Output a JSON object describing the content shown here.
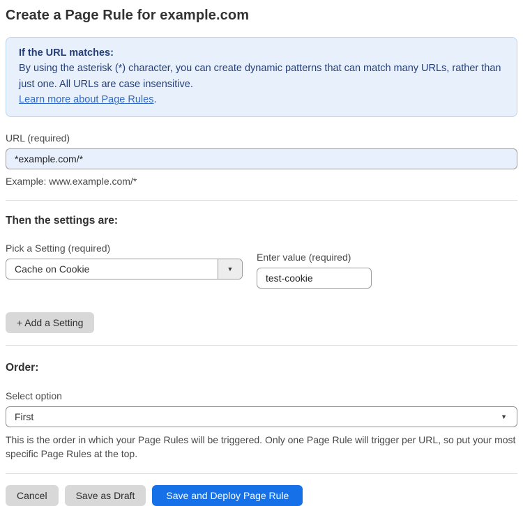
{
  "page": {
    "title": "Create a Page Rule for example.com"
  },
  "info_box": {
    "heading": "If the URL matches:",
    "body": "By using the asterisk (*) character, you can create dynamic patterns that can match many URLs, rather than just one. All URLs are case insensitive.",
    "link_label": "Learn more about Page Rules",
    "link_suffix": "."
  },
  "url_field": {
    "label": "URL (required)",
    "value": "*example.com/*",
    "helper": "Example: www.example.com/*"
  },
  "settings": {
    "heading": "Then the settings are:",
    "setting_label": "Pick a Setting (required)",
    "setting_selected": "Cache on Cookie",
    "value_label": "Enter value (required)",
    "value_text": "test-cookie",
    "add_button_label": "+ Add a Setting"
  },
  "order": {
    "heading": "Order:",
    "select_label": "Select option",
    "select_selected": "First",
    "helper": "This is the order in which your Page Rules will be triggered. Only one Page Rule will trigger per URL, so put your most specific Page Rules at the top."
  },
  "footer": {
    "cancel_label": "Cancel",
    "save_draft_label": "Save as Draft",
    "save_deploy_label": "Save and Deploy Page Rule"
  },
  "icons": {
    "dropdown_arrow": "▼"
  },
  "colors": {
    "info_bg": "#e8f1fb",
    "info_border": "#b7d5f0",
    "info_text": "#253e78",
    "link_blue": "#3069c9",
    "url_input_bg": "#e8f0fe",
    "primary_button_blue": "#1670e8",
    "gray_button": "#d8d8d8"
  }
}
